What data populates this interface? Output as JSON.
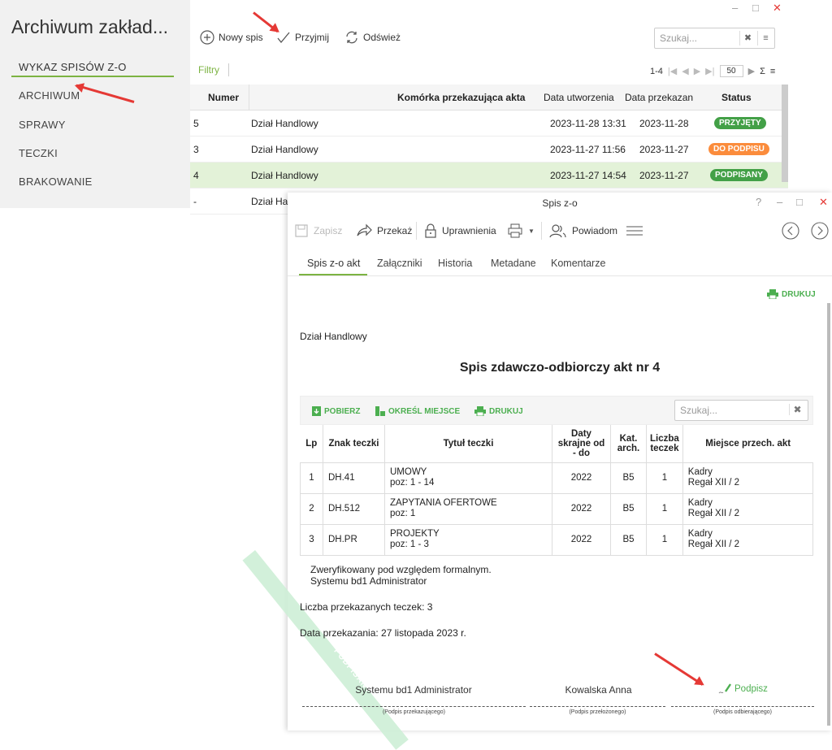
{
  "app": {
    "title": "Archiwum zakład...",
    "window_controls": {
      "minimize": "–",
      "maximize": "□",
      "close": "✕"
    }
  },
  "sidebar": {
    "items": [
      {
        "label": "WYKAZ SPISÓW Z-O",
        "active": true
      },
      {
        "label": "ARCHIWUM"
      },
      {
        "label": "SPRAWY"
      },
      {
        "label": "TECZKI"
      },
      {
        "label": "BRAKOWANIE"
      }
    ]
  },
  "toolbar": {
    "new_label": "Nowy spis",
    "accept_label": "Przyjmij",
    "refresh_label": "Odśwież",
    "search_placeholder": "Szukaj..."
  },
  "filter_bar": {
    "filters_label": "Filtry",
    "range": "1-4",
    "page_size": "50"
  },
  "list_table": {
    "columns": [
      "Numer",
      "Komórka przekazująca akta",
      "Data utworzenia",
      "Data przekazan",
      "Status"
    ],
    "rows": [
      {
        "number": "5",
        "unit": "Dział Handlowy",
        "created": "2023-11-28 13:31",
        "handed": "2023-11-28",
        "status": "PRZYJĘTY",
        "status_color": "#43a047"
      },
      {
        "number": "3",
        "unit": "Dział Handlowy",
        "created": "2023-11-27 11:56",
        "handed": "2023-11-27",
        "status": "DO PODPISU",
        "status_color": "#fb8c3c"
      },
      {
        "number": "4",
        "unit": "Dział Handlowy",
        "created": "2023-11-27 14:54",
        "handed": "2023-11-27",
        "status": "PODPISANY",
        "status_color": "#43a047"
      },
      {
        "number": "-",
        "unit": "Dział Han",
        "created": "",
        "handed": "",
        "status": ""
      }
    ]
  },
  "dialog": {
    "title": "Spis z-o",
    "help": "?",
    "toolbar": {
      "save": "Zapisz",
      "forward": "Przekaż",
      "permissions": "Uprawnienia",
      "notify": "Powiadom"
    },
    "tabs": [
      "Spis z-o akt",
      "Załączniki",
      "Historia",
      "Metadane",
      "Komentarze"
    ],
    "print_label": "DRUKUJ",
    "document": {
      "department": "Dział Handlowy",
      "title": "Spis zdawczo-odbiorczy akt nr 4",
      "actions": {
        "download": "POBIERZ",
        "set_place": "OKREŚL MIEJSCE",
        "print": "DRUKUJ"
      },
      "search_placeholder": "Szukaj...",
      "table": {
        "columns": [
          "Lp",
          "Znak teczki",
          "Tytuł teczki",
          "Daty skrajne od - do",
          "Kat. arch.",
          "Liczba teczek",
          "Miejsce przech. akt"
        ],
        "rows": [
          {
            "lp": "1",
            "sign": "DH.41",
            "title": "UMOWY",
            "pos": "poz: 1 - 14",
            "dates": "2022",
            "cat": "B5",
            "count": "1",
            "place1": "Kadry",
            "place2": "Regał XII / 2"
          },
          {
            "lp": "2",
            "sign": "DH.512",
            "title": "ZAPYTANIA OFERTOWE",
            "pos": "poz: 1",
            "dates": "2022",
            "cat": "B5",
            "count": "1",
            "place1": "Kadry",
            "place2": "Regał XII / 2"
          },
          {
            "lp": "3",
            "sign": "DH.PR",
            "title": "PROJEKTY",
            "pos": "poz: 1 - 3",
            "dates": "2022",
            "cat": "B5",
            "count": "1",
            "place1": "Kadry",
            "place2": "Regał XII / 2"
          }
        ]
      },
      "verified_line1": "Zweryfikowany pod względem formalnym.",
      "verified_line2": "Systemu bd1 Administrator",
      "count_text": "Liczba przekazanych teczek: 3",
      "date_text": "Data przekazania: 27 listopada 2023 r.",
      "watermark": "PODPISANY",
      "signatures": {
        "giver_name": "Systemu bd1 Administrator",
        "giver_caption": "(Podpis przekazującego)",
        "supervisor_name": "Kowalska Anna",
        "supervisor_caption": "(Podpis przełożonego)",
        "sign_label": "Podpisz",
        "receiver_caption": "(Podpis odbierającego)"
      }
    }
  },
  "colors": {
    "accent": "#7cb342",
    "highlight_row": "#e3f2d8",
    "annotation": "#e53935"
  }
}
